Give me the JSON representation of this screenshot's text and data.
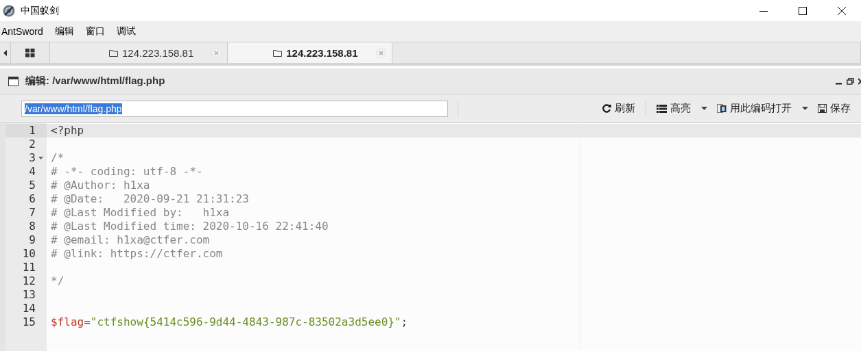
{
  "window": {
    "title": "中国蚁剑"
  },
  "menu": [
    "AntSword",
    "编辑",
    "窗口",
    "调试"
  ],
  "tabs": [
    {
      "label": "124.223.158.81",
      "selected": false
    },
    {
      "label": "124.223.158.81",
      "selected": true
    }
  ],
  "panel": {
    "title": "编辑: /var/www/html/flag.php"
  },
  "toolbar": {
    "path": "/var/www/html/flag.php",
    "path_selected": true,
    "buttons": [
      {
        "label": "刷新",
        "dropdown": false
      },
      {
        "label": "高亮",
        "dropdown": true
      },
      {
        "label": "用此编码打开",
        "dropdown": true
      },
      {
        "label": "保存",
        "dropdown": false
      }
    ]
  },
  "editor": {
    "lines": [
      {
        "number": "1",
        "active": true,
        "fold": false,
        "tokens": [
          {
            "kind": "meta",
            "text": "<?php"
          }
        ]
      },
      {
        "number": "2",
        "active": false,
        "fold": false
      },
      {
        "number": "3",
        "active": false,
        "fold": true,
        "tokens": [
          {
            "kind": "comment",
            "text": "/*"
          }
        ]
      },
      {
        "number": "4",
        "active": false,
        "fold": false,
        "tokens": [
          {
            "kind": "comment",
            "text": "# -*- coding: utf-8 -*-"
          }
        ]
      },
      {
        "number": "5",
        "active": false,
        "fold": false,
        "tokens": [
          {
            "kind": "comment",
            "text": "# @Author: h1xa"
          }
        ]
      },
      {
        "number": "6",
        "active": false,
        "fold": false,
        "tokens": [
          {
            "kind": "comment",
            "text": "# @Date:   2020-09-21 21:31:23"
          }
        ]
      },
      {
        "number": "7",
        "active": false,
        "fold": false,
        "tokens": [
          {
            "kind": "comment",
            "text": "# @Last Modified by:   h1xa"
          }
        ]
      },
      {
        "number": "8",
        "active": false,
        "fold": false,
        "tokens": [
          {
            "kind": "comment",
            "text": "# @Last Modified time: 2020-10-16 22:41:40"
          }
        ]
      },
      {
        "number": "9",
        "active": false,
        "fold": false,
        "tokens": [
          {
            "kind": "comment",
            "text": "# @email: h1xa@ctfer.com"
          }
        ]
      },
      {
        "number": "10",
        "active": false,
        "fold": false,
        "tokens": [
          {
            "kind": "comment",
            "text": "# @link: https://ctfer.com"
          }
        ]
      },
      {
        "number": "11",
        "active": false,
        "fold": false
      },
      {
        "number": "12",
        "active": false,
        "fold": false,
        "tokens": [
          {
            "kind": "comment",
            "text": "*/"
          }
        ]
      },
      {
        "number": "13",
        "active": false,
        "fold": false
      },
      {
        "number": "14",
        "active": false,
        "fold": false
      },
      {
        "number": "15",
        "active": false,
        "fold": false,
        "tokens": [
          {
            "kind": "variable",
            "text": "$flag"
          },
          {
            "kind": "operator",
            "text": "="
          },
          {
            "kind": "string",
            "text": "\"ctfshow{5414c596-9d44-4843-987c-83502a3d5ee0}\""
          },
          {
            "kind": "plain",
            "text": ";"
          }
        ]
      }
    ]
  }
}
